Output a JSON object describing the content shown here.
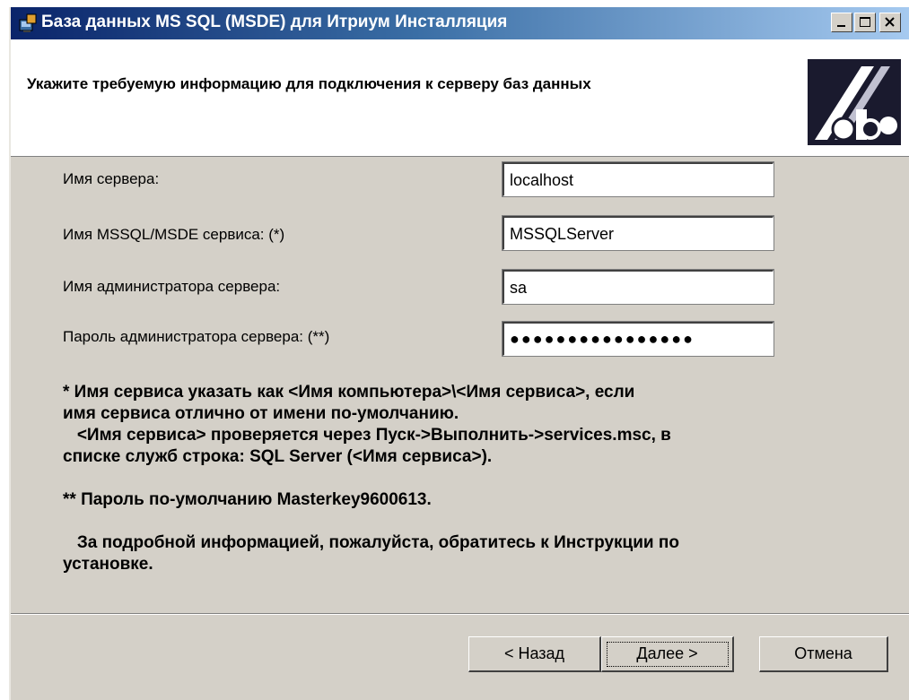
{
  "window": {
    "title": "База данных MS SQL (MSDE) для Итриум Инсталляция"
  },
  "header": {
    "text": "Укажите требуемую информацию для подключения к серверу баз данных"
  },
  "form": {
    "server_name": {
      "label": "Имя сервера:",
      "value": "localhost"
    },
    "service_name": {
      "label": "Имя MSSQL/MSDE сервиса: (*)",
      "value": "MSSQLServer"
    },
    "admin_name": {
      "label": "Имя администратора сервера:",
      "value": "sa"
    },
    "admin_password": {
      "label": "Пароль администратора сервера: (**)",
      "value": "●●●●●●●●●●●●●●●●"
    }
  },
  "notes": {
    "note1_line1": "*  Имя сервиса указать как <Имя компьютера>\\<Имя сервиса>, если",
    "note1_line2": "имя сервиса отлично от имени по-умолчанию.",
    "note1_line3": "   <Имя сервиса> проверяется через Пуск->Выполнить->services.msc, в",
    "note1_line4": "списке служб строка: SQL Server (<Имя сервиса>).",
    "note2": "** Пароль по-умолчанию Masterkey9600613.",
    "note3_line1": "   За подробной информацией, пожалуйста, обратитесь к Инструкции по",
    "note3_line2": "установке."
  },
  "buttons": {
    "back": "< Назад",
    "next": "Далее >",
    "cancel": "Отмена"
  },
  "icons": {
    "app_icon": "installer-icon",
    "logo": "itrium-logo",
    "minimize": "minimize-icon",
    "maximize": "maximize-icon",
    "close": "close-icon"
  },
  "colors": {
    "titlebar_start": "#0a246a",
    "titlebar_end": "#a6caf0",
    "dialog_bg": "#d4d0c8"
  }
}
